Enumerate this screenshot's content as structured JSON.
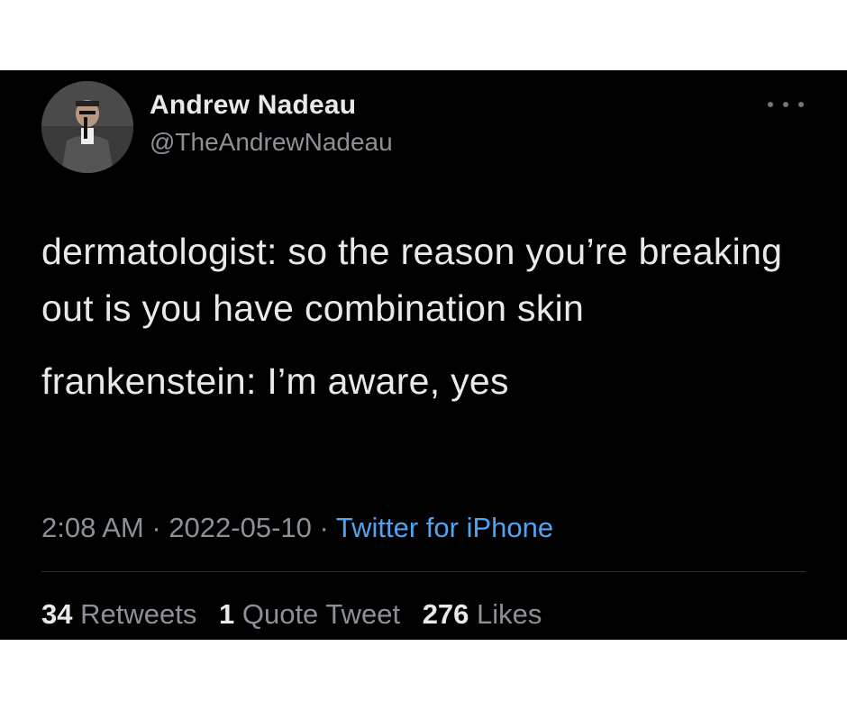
{
  "tweet": {
    "author": {
      "display_name": "Andrew Nadeau",
      "handle": "@TheAndrewNadeau",
      "avatar_icon": "profile-photo"
    },
    "body": {
      "line1": "dermatologist: so the reason you’re breaking out is you have combination skin",
      "line2": "frankenstein: I’m aware, yes"
    },
    "meta": {
      "time": "2:08 AM",
      "sep1": " · ",
      "date": "2022-05-10",
      "sep2": " · ",
      "source": "Twitter for iPhone"
    },
    "stats": {
      "retweets_count": "34",
      "retweets_label": "Retweets",
      "quotes_count": "1",
      "quotes_label": "Quote Tweet",
      "likes_count": "276",
      "likes_label": "Likes"
    },
    "more_icon": "more-horizontal-icon"
  },
  "colors": {
    "background": "#000000",
    "text_primary": "#e7e9ea",
    "text_secondary": "#8b9197",
    "link": "#4fa3f0",
    "divider": "#2f3336"
  }
}
